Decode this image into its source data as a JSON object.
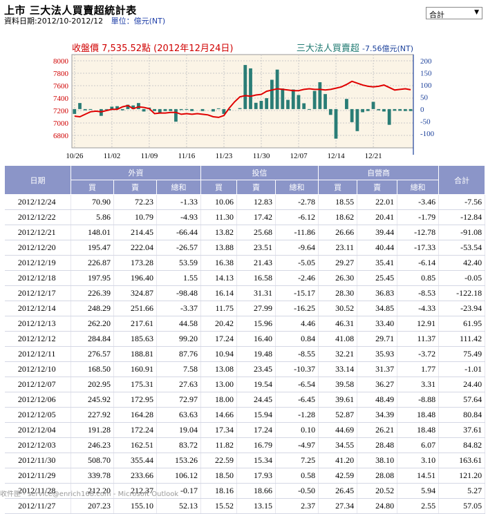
{
  "header": {
    "title": "上市 三大法人買賣超統計表",
    "date_range": "資料日期:2012/10-2012/12",
    "unit": "單位：億元(NT)"
  },
  "select": {
    "value": "合計",
    "arrow": "▼"
  },
  "chart_data": {
    "type": "bar",
    "title_left": "收盤價 7,535.52點 (2012年12月24日)",
    "title_right_name": "三大法人買賣超",
    "title_right_value": "-7.56億元(NT)",
    "x_tick_labels": [
      "10/26",
      "11/02",
      "11/09",
      "11/16",
      "11/23",
      "11/30",
      "12/07",
      "12/14",
      "12/21"
    ],
    "left_axis": {
      "ylim": [
        6600,
        8100
      ],
      "ticks": [
        6800,
        7000,
        7200,
        7400,
        7600,
        7800,
        8000
      ],
      "color": "#d00000"
    },
    "right_axis": {
      "ylim": [
        -160,
        225
      ],
      "ticks": [
        -100,
        -50,
        0,
        50,
        100,
        150,
        200
      ],
      "color": "#1a3f9a"
    },
    "series": [
      {
        "name": "收盤價",
        "color": "#e00000",
        "values": [
          7110,
          7100,
          7140,
          7180,
          7190,
          7180,
          7200,
          7220,
          7220,
          7260,
          7280,
          7230,
          7260,
          7250,
          7230,
          7150,
          7160,
          7160,
          7170,
          7170,
          7140,
          7150,
          7140,
          7150,
          7140,
          7130,
          7100,
          7090,
          7120,
          7240,
          7340,
          7420,
          7440,
          7430,
          7450,
          7460,
          7510,
          7530,
          7550,
          7540,
          7530,
          7520,
          7520,
          7540,
          7550,
          7540,
          7540,
          7530,
          7540,
          7560,
          7580,
          7620,
          7670,
          7640,
          7610,
          7590,
          7580,
          7590,
          7610,
          7570,
          7530,
          7540,
          7550,
          7535
        ]
      },
      {
        "name": "三大法人買賣超",
        "color": "#2a7d76",
        "values": [
          -20,
          25,
          -5,
          -3,
          0,
          -28,
          -1,
          10,
          12,
          -5,
          18,
          15,
          25,
          -10,
          6,
          -8,
          -15,
          -8,
          -8,
          -52,
          -4,
          -3,
          -8,
          0,
          -8,
          0,
          -10,
          3,
          -20,
          -5,
          0,
          4,
          182,
          168,
          26,
          34,
          45,
          121,
          163,
          85,
          38,
          81,
          58,
          24,
          -1,
          75,
          111,
          62,
          -24,
          -122,
          0,
          42,
          -54,
          -91,
          -13,
          -8,
          30,
          -5,
          -10,
          -65,
          -7,
          -7,
          -8,
          -8
        ]
      }
    ]
  },
  "table": {
    "headers": {
      "date": "日期",
      "foreign": "外資",
      "trust": "投信",
      "dealer": "自營商",
      "total": "合計",
      "buy": "買",
      "sell": "賣",
      "net": "總和"
    },
    "rows": [
      [
        "2012/12/24",
        "70.90",
        "72.23",
        "-1.33",
        "10.06",
        "12.83",
        "-2.78",
        "18.55",
        "22.01",
        "-3.46",
        "-7.56"
      ],
      [
        "2012/12/22",
        "5.86",
        "10.79",
        "-4.93",
        "11.30",
        "17.42",
        "-6.12",
        "18.62",
        "20.41",
        "-1.79",
        "-12.84"
      ],
      [
        "2012/12/21",
        "148.01",
        "214.45",
        "-66.44",
        "13.82",
        "25.68",
        "-11.86",
        "26.66",
        "39.44",
        "-12.78",
        "-91.08"
      ],
      [
        "2012/12/20",
        "195.47",
        "222.04",
        "-26.57",
        "13.88",
        "23.51",
        "-9.64",
        "23.11",
        "40.44",
        "-17.33",
        "-53.54"
      ],
      [
        "2012/12/19",
        "226.87",
        "173.28",
        "53.59",
        "16.38",
        "21.43",
        "-5.05",
        "29.27",
        "35.41",
        "-6.14",
        "42.40"
      ],
      [
        "2012/12/18",
        "197.95",
        "196.40",
        "1.55",
        "14.13",
        "16.58",
        "-2.46",
        "26.30",
        "25.45",
        "0.85",
        "-0.05"
      ],
      [
        "2012/12/17",
        "226.39",
        "324.87",
        "-98.48",
        "16.14",
        "31.31",
        "-15.17",
        "28.30",
        "36.83",
        "-8.53",
        "-122.18"
      ],
      [
        "2012/12/14",
        "248.29",
        "251.66",
        "-3.37",
        "11.75",
        "27.99",
        "-16.25",
        "30.52",
        "34.85",
        "-4.33",
        "-23.94"
      ],
      [
        "2012/12/13",
        "262.20",
        "217.61",
        "44.58",
        "20.42",
        "15.96",
        "4.46",
        "46.31",
        "33.40",
        "12.91",
        "61.95"
      ],
      [
        "2012/12/12",
        "284.84",
        "185.63",
        "99.20",
        "17.24",
        "16.40",
        "0.84",
        "41.08",
        "29.71",
        "11.37",
        "111.42"
      ],
      [
        "2012/12/11",
        "276.57",
        "188.81",
        "87.76",
        "10.94",
        "19.48",
        "-8.55",
        "32.21",
        "35.93",
        "-3.72",
        "75.49"
      ],
      [
        "2012/12/10",
        "168.50",
        "160.91",
        "7.58",
        "13.08",
        "23.45",
        "-10.37",
        "33.14",
        "31.37",
        "1.77",
        "-1.01"
      ],
      [
        "2012/12/07",
        "202.95",
        "175.31",
        "27.63",
        "13.00",
        "19.54",
        "-6.54",
        "39.58",
        "36.27",
        "3.31",
        "24.40"
      ],
      [
        "2012/12/06",
        "245.92",
        "172.95",
        "72.97",
        "18.00",
        "24.45",
        "-6.45",
        "39.61",
        "48.49",
        "-8.88",
        "57.64"
      ],
      [
        "2012/12/05",
        "227.92",
        "164.28",
        "63.63",
        "14.66",
        "15.94",
        "-1.28",
        "52.87",
        "34.39",
        "18.48",
        "80.84"
      ],
      [
        "2012/12/04",
        "191.28",
        "172.24",
        "19.04",
        "17.34",
        "17.24",
        "0.10",
        "44.69",
        "26.21",
        "18.48",
        "37.61"
      ],
      [
        "2012/12/03",
        "246.23",
        "162.51",
        "83.72",
        "11.82",
        "16.79",
        "-4.97",
        "34.55",
        "28.48",
        "6.07",
        "84.82"
      ],
      [
        "2012/11/30",
        "508.70",
        "355.44",
        "153.26",
        "22.59",
        "15.34",
        "7.25",
        "41.20",
        "38.10",
        "3.10",
        "163.61"
      ],
      [
        "2012/11/29",
        "339.78",
        "233.66",
        "106.12",
        "18.50",
        "17.93",
        "0.58",
        "42.59",
        "28.08",
        "14.51",
        "121.20"
      ],
      [
        "2012/11/28",
        "212.20",
        "212.37",
        "-0.17",
        "18.16",
        "18.66",
        "-0.50",
        "26.45",
        "20.52",
        "5.94",
        "5.27"
      ],
      [
        "2012/11/27",
        "207.23",
        "155.10",
        "52.13",
        "15.52",
        "13.15",
        "2.37",
        "27.34",
        "24.80",
        "2.55",
        "57.05"
      ]
    ]
  },
  "statusbar": {
    "text": "收件匣 - service@enrich168.com - Microsoft Outlook"
  }
}
